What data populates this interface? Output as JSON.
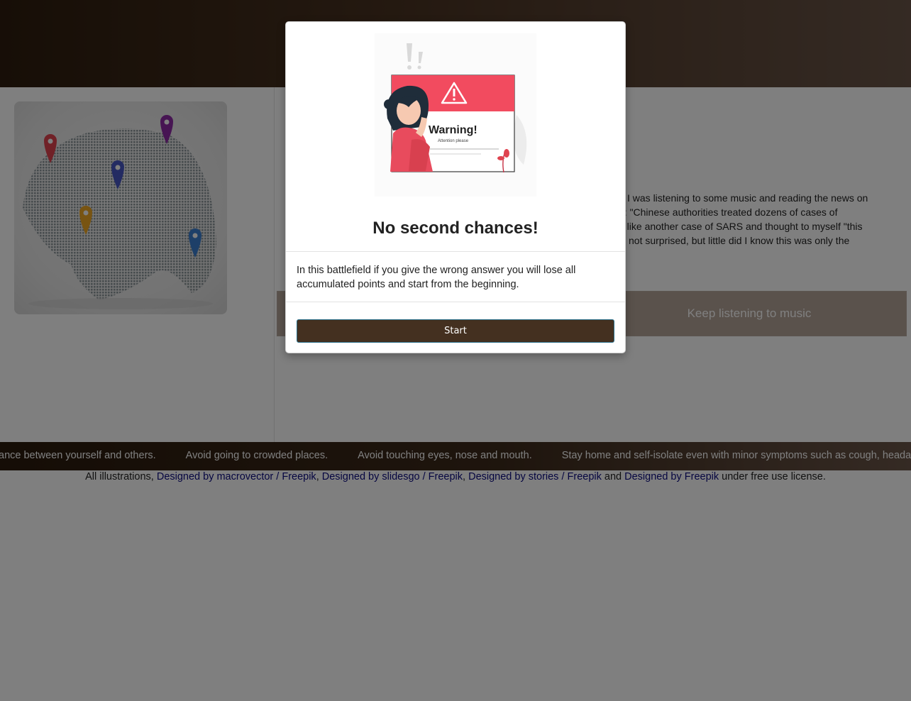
{
  "page": {
    "story_lines": [
      "I was listening to some music and reading the news on",
      "d: \"Chinese authorities treated dozens of cases of",
      "d like another case of SARS and thought to myself \"this",
      "not surprised, but little did I know this was only the"
    ],
    "choices": {
      "right_label": "Keep listening to music"
    },
    "map_image_icon": "world-map-with-location-pins-icon"
  },
  "ticker": {
    "items": [
      "ance between yourself and others.",
      "Avoid going to crowded places.",
      "Avoid touching eyes, nose and mouth.",
      "Stay home and self-isolate even with minor symptoms such as cough, headache"
    ]
  },
  "credits": {
    "prefix": "All illustrations,",
    "link1": "Designed by macrovector / Freepik",
    "sep1": ",",
    "link2": "Designed by slidesgo / Freepik",
    "sep2": ",",
    "link3": "Designed by stories / Freepik",
    "and": "and",
    "link4": "Designed by Freepik",
    "suffix": "under free use license."
  },
  "modal": {
    "illustration_icon": "warning-illustration-icon",
    "illustration_text": {
      "heading": "Warning!",
      "sub": "Attention please"
    },
    "title": "No second chances!",
    "body": "In this battlefield if you give the wrong answer you will lose all accumulated points and start from the beginning.",
    "start_label": "Start"
  },
  "colors": {
    "accent": "#443020",
    "warning_red": "#f24b5f",
    "link": "#0a0a80"
  }
}
